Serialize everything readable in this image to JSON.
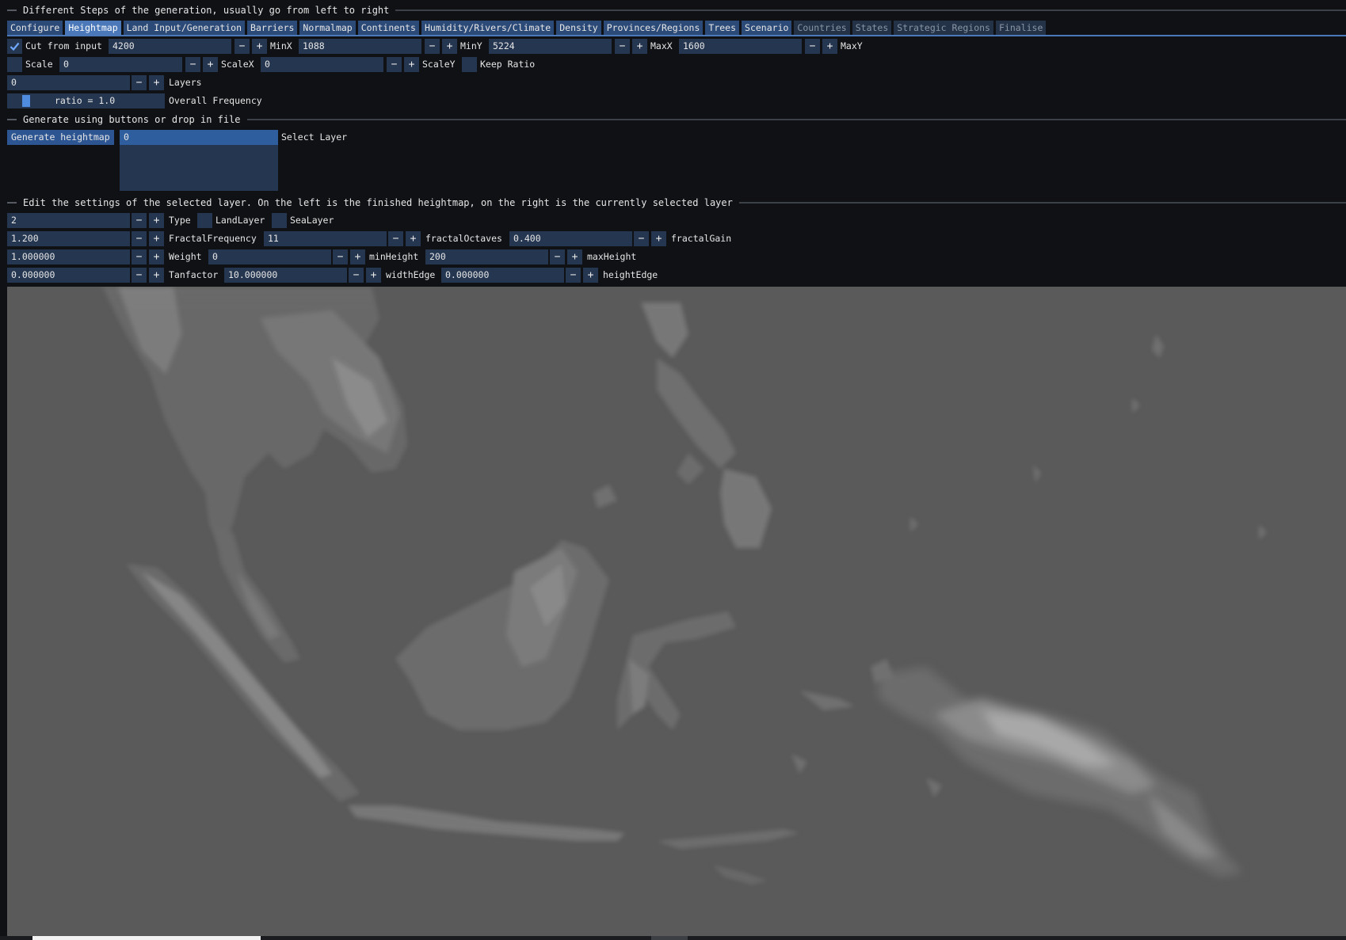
{
  "sections": {
    "steps": "Different Steps of the generation, usually go from left to right",
    "generate": "Generate using buttons or drop in file",
    "edit": "Edit the settings of the selected layer. On the left is the finished heightmap, on the right is the currently selected layer"
  },
  "tabs": [
    {
      "label": "Configure",
      "state": "normal"
    },
    {
      "label": "Heightmap",
      "state": "active"
    },
    {
      "label": "Land Input/Generation",
      "state": "normal"
    },
    {
      "label": "Barriers",
      "state": "normal"
    },
    {
      "label": "Normalmap",
      "state": "normal"
    },
    {
      "label": "Continents",
      "state": "normal"
    },
    {
      "label": "Humidity/Rivers/Climate",
      "state": "normal"
    },
    {
      "label": "Density",
      "state": "normal"
    },
    {
      "label": "Provinces/Regions",
      "state": "normal"
    },
    {
      "label": "Trees",
      "state": "normal"
    },
    {
      "label": "Scenario",
      "state": "normal"
    },
    {
      "label": "Countries",
      "state": "disabled"
    },
    {
      "label": "States",
      "state": "disabled"
    },
    {
      "label": "Strategic Regions",
      "state": "disabled"
    },
    {
      "label": "Finalise",
      "state": "disabled"
    }
  ],
  "cut": {
    "checkbox_label": "Cut from input",
    "checked": true,
    "minx": {
      "value": "4200",
      "label": "MinX"
    },
    "miny": {
      "value": "1088",
      "label": "MinY"
    },
    "maxx": {
      "value": "5224",
      "label": "MaxX"
    },
    "maxy": {
      "value": "1600",
      "label": "MaxY"
    }
  },
  "scale": {
    "checkbox_label": "Scale",
    "scalex": {
      "value": "0",
      "label": "ScaleX"
    },
    "scaley": {
      "value": "0",
      "label": "ScaleY"
    },
    "keep_ratio_label": "Keep Ratio"
  },
  "layers": {
    "value": "0",
    "label": "Layers"
  },
  "frequency": {
    "slider_text": "ratio = 1.0",
    "label": "Overall Frequency"
  },
  "generate": {
    "button_label": "Generate heightmap",
    "selected_item": "0",
    "select_label": "Select Layer"
  },
  "layer": {
    "type": {
      "value": "2",
      "label": "Type"
    },
    "land_layer_label": "LandLayer",
    "sea_layer_label": "SeaLayer",
    "fractal_frequency": {
      "value": "1.200",
      "label": "FractalFrequency"
    },
    "fractal_octaves": {
      "value": "11",
      "label": "fractalOctaves"
    },
    "fractal_gain": {
      "value": "0.400",
      "label": "fractalGain"
    },
    "weight": {
      "value": "1.000000",
      "label": "Weight"
    },
    "min_height": {
      "value": "0",
      "label": "minHeight"
    },
    "max_height": {
      "value": "200",
      "label": "maxHeight"
    },
    "tanfactor": {
      "value": "0.000000",
      "label": "Tanfactor"
    },
    "width_edge": {
      "value": "10.000000",
      "label": "widthEdge"
    },
    "height_edge": {
      "value": "0.000000",
      "label": "heightEdge"
    }
  },
  "icons": {
    "minus": "−",
    "plus": "+"
  },
  "colors": {
    "accent": "#4a78b8",
    "button": "#2c5592",
    "frame": "#253650",
    "map_sea": "#5a5a5a"
  }
}
